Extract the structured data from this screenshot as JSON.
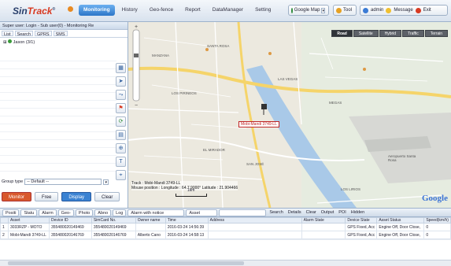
{
  "app": {
    "brand_a": "Sin",
    "brand_b": "Track",
    "brand_mark": "®"
  },
  "nav": {
    "tabs": [
      "Monitoring",
      "History",
      "Geo-fence",
      "Report",
      "DataManager",
      "Setting"
    ],
    "active": 0
  },
  "header_right": {
    "map_select": "Google Map",
    "tool": "Tool",
    "user": "admin",
    "message": "Message",
    "exit": "Exit"
  },
  "left_panel": {
    "title": "Super user: Login - Sub user(0) - Monitoring Re",
    "tabs": [
      "List",
      "Search",
      "GPRS",
      "SMS"
    ],
    "tree_item": "Jason (3/1)",
    "group_label": "Group type",
    "group_value": "-- Default --",
    "buttons": [
      "Monitor",
      "Free",
      "Display",
      "Clear"
    ]
  },
  "toolbar": {
    "icons": [
      "grid-icon",
      "cursor-icon",
      "route-icon",
      "flag-icon",
      "refresh-icon",
      "ruler-icon",
      "zoom-icon",
      "text-icon",
      "pin-icon"
    ]
  },
  "map": {
    "types": [
      "Road",
      "Satellite",
      "Hybrid",
      "Traffic",
      "Terrain"
    ],
    "active_type": "Road",
    "marker_label": "Mobi-Mandi 3749-LL",
    "track_info_1": "Track : Mobi-Mandi 3749-LL",
    "track_info_2": "Mouse position : Longitude : 64.7,9000° Latitude : 21.904466",
    "scale_label": "1km",
    "logo": "Google",
    "place_labels": [
      "MANZANA",
      "SANTA ROSA",
      "LOS PIRINEOS",
      "LAS VEGAS",
      "EL MIRADOR",
      "MEGAS",
      "SAN JOSÉ",
      "Aeropuerto Santa Rosa",
      "LOS LIRIOS"
    ]
  },
  "bottom_tabs": {
    "items": [
      "Positi",
      "Statu",
      "Alarm",
      "Geo-",
      "Photo",
      "Abno",
      "Log"
    ],
    "alarm_select": "Alarm with notice",
    "asset_select": "Asset",
    "actions": [
      "Search",
      "Details",
      "Clear",
      "Output",
      "POI",
      "Hidden"
    ]
  },
  "table": {
    "columns": [
      "",
      "Asset",
      "Device ID",
      "SimCard No.",
      "Owner name",
      "Time",
      "Address",
      "Alarm State",
      "Device State",
      "Asset Status",
      "Speed(km/h)"
    ],
    "rows": [
      [
        "1",
        "3033RZP - MOTO",
        "355480020149469",
        "355480020149469",
        "",
        "2016-03-24 14:56:39",
        "",
        "",
        "GPS Fixed, Acc",
        "Engine Off, Door Close,",
        "0"
      ],
      [
        "2",
        "Mobi-Mandi 3749-LL",
        "355480020146769",
        "355480020146769",
        "Alberto Cano",
        "2016-03-24 14:58:13",
        "",
        "",
        "GPS Fixed, Acc",
        "Engine Off, Door Close,",
        "0"
      ]
    ]
  },
  "colors": {
    "accent": "#2d77c8",
    "track": "#c02626",
    "brand_red": "#d83a22",
    "water": "#9ec3e6",
    "road": "#f6d66a"
  }
}
